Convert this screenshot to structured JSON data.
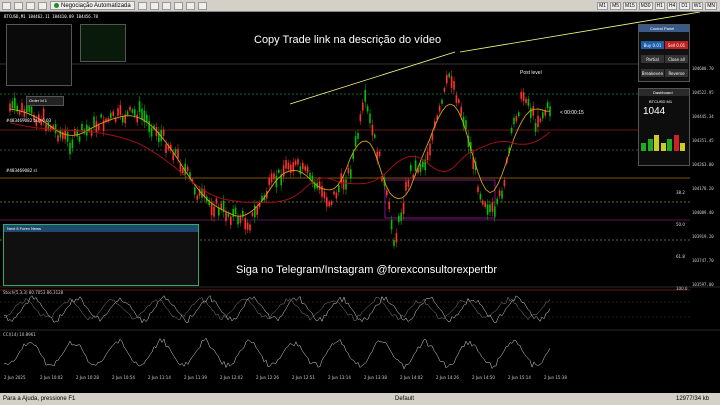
{
  "toolbar": {
    "algo_label": "Negociação Automatizada",
    "timeframes": [
      "M1",
      "M5",
      "M15",
      "M30",
      "H1",
      "H4",
      "D1",
      "W1",
      "MN"
    ]
  },
  "overlays": {
    "copy_trade": "Copy Trade link na descrição do vídeo",
    "telegram": "Siga no Telegram/Instagram @forexconsultorexpertbr",
    "post_level": "Post level",
    "timer": "< 00:00:15"
  },
  "chart": {
    "symbol_line": "BTCUSD,M1  104462.11 104410.89 104456.78",
    "price_labels": [
      "104600.70",
      "104522.95",
      "104445.34",
      "104351.45",
      "104263.00",
      "104178.20",
      "104089.40",
      "103919.20",
      "103747.70",
      "103597.00"
    ],
    "markers": [
      "#483469082 buy 0.03",
      "#483469082 sl",
      "Order Id 1"
    ],
    "time_labels": [
      "2 Jun 2025",
      "2 Jun 10:02",
      "2 Jun 10:28",
      "2 Jun 10:54",
      "2 Jun 11:14",
      "2 Jun 11:39",
      "2 Jun 12:02",
      "2 Jun 12:26",
      "2 Jun 12:51",
      "2 Jun 13:14",
      "2 Jun 13:38",
      "2 Jun 14:02",
      "2 Jun 14:26",
      "2 Jun 14:50",
      "2 Jun 15:14",
      "2 Jun 15:38"
    ],
    "indicator1": "Stoch(5,3,3) 80.7053 86.3128",
    "indicator2": "CCI(14) 10.8961",
    "levels": [
      "0.0",
      "23.6",
      "38.2",
      "50.0",
      "61.8",
      "100.0"
    ]
  },
  "panels": {
    "control_title": "Control Panel",
    "dashboard_title": "Dashboard",
    "dashboard_symbol": "BTCUSD M1",
    "dashboard_price": "1044",
    "buttons": [
      "Buy 0.01",
      "Sell 0.01",
      "Partial",
      "Close all",
      "Breakeven",
      "Reverse"
    ],
    "news_title": "Next 8 Forex News"
  },
  "footer": {
    "help": "Para a Ajuda, pressione F1",
    "profile": "Default",
    "traffic": "12977/34 kb"
  },
  "colors": {
    "up": "#00c000",
    "down": "#ff3030",
    "ma_fast": "#d4a020",
    "ma_slow": "#a01010",
    "accent": "#ffff00"
  }
}
